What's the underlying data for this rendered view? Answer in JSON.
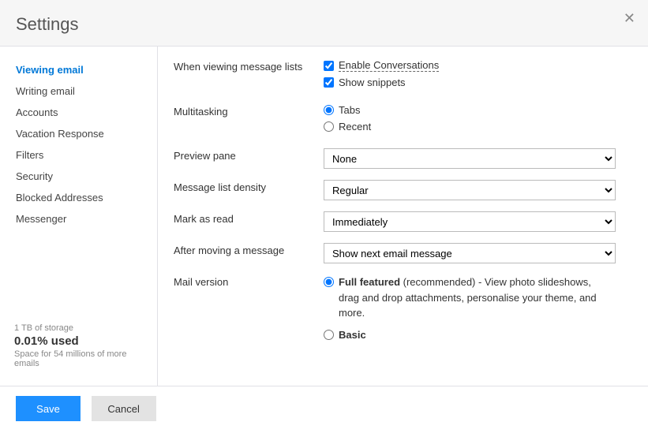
{
  "header": {
    "title": "Settings"
  },
  "sidebar": {
    "items": [
      "Viewing email",
      "Writing email",
      "Accounts",
      "Vacation Response",
      "Filters",
      "Security",
      "Blocked Addresses",
      "Messenger"
    ],
    "active_index": 0
  },
  "storage": {
    "total": "1 TB of storage",
    "used": "0.01% used",
    "note": "Space for 54 millions of more emails"
  },
  "settings": {
    "viewing_lists_label": "When viewing message lists",
    "enable_conversations": "Enable Conversations",
    "show_snippets": "Show snippets",
    "multitasking_label": "Multitasking",
    "tabs": "Tabs",
    "recent": "Recent",
    "preview_pane_label": "Preview pane",
    "preview_pane_value": "None",
    "density_label": "Message list density",
    "density_value": "Regular",
    "mark_read_label": "Mark as read",
    "mark_read_value": "Immediately",
    "after_move_label": "After moving a message",
    "after_move_value": "Show next email message",
    "mail_version_label": "Mail version",
    "full_featured_title": "Full featured",
    "full_featured_note": " (recommended) - View photo slideshows, drag and drop attachments, personalise your theme, and more.",
    "basic": "Basic"
  },
  "footer": {
    "save": "Save",
    "cancel": "Cancel"
  }
}
